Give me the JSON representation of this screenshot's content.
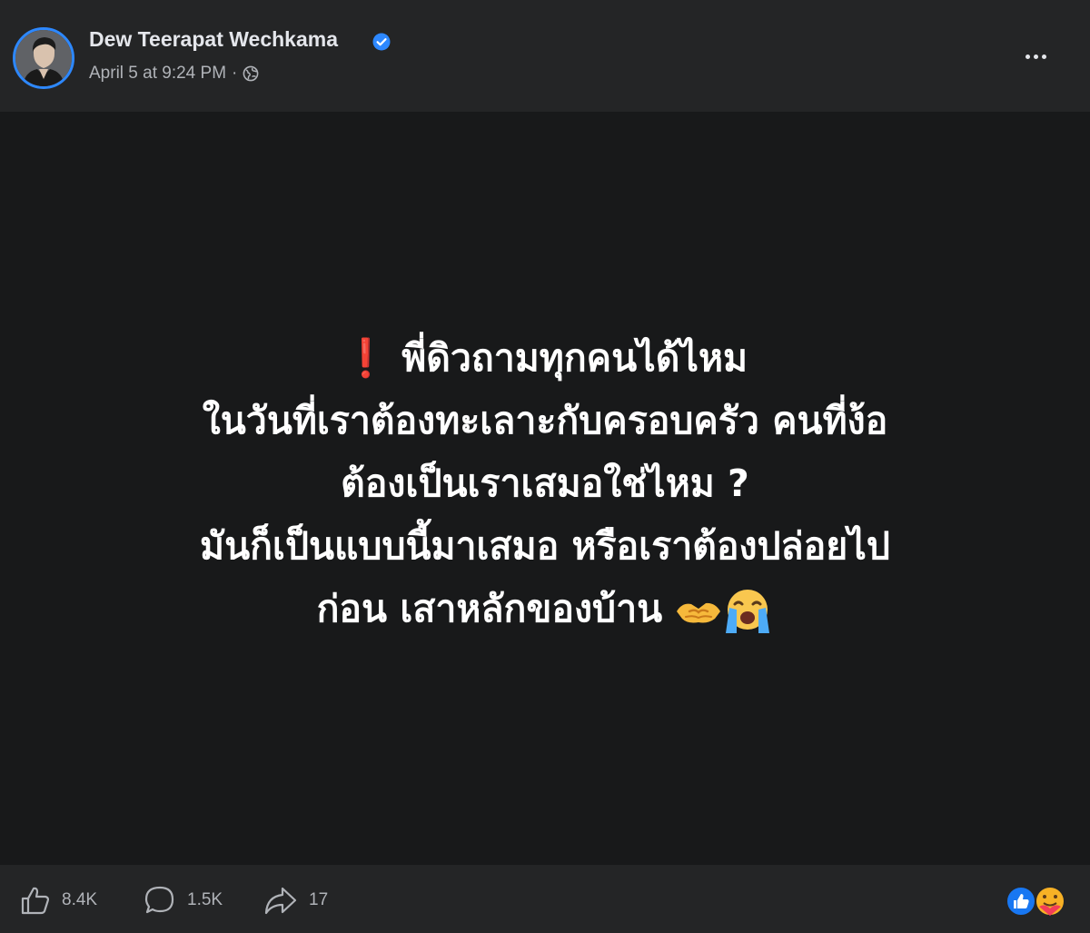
{
  "post": {
    "author": "Dew Teerapat Wechkama",
    "timestamp": "April 5 at 9:24 PM",
    "separator": "·",
    "verified_icon": "verified-badge-icon",
    "audience_icon": "globe-icon",
    "more_icon": "more-options-icon",
    "body_lines": [
      "❗ พี่ดิวถามทุกคนได้ไหม",
      "ในวันที่เราต้องทะเลาะกับครอบครัว คนที่ง้อ",
      "ต้องเป็นเราเสมอใช่ไหม ?",
      "มันก็เป็นแบบนี้มาเสมอ หรือเราต้องปล่อยไป",
      "ก่อน เสาหลักของบ้าน"
    ],
    "body_emojis": [
      "handshake-emoji",
      "crying-face-emoji"
    ],
    "colors": {
      "background": "#18191a",
      "header": "#242526",
      "accent": "#2d88ff",
      "text": "#ffffff",
      "secondary_text": "#b0b3b8",
      "exclamation": "#e0243b"
    }
  },
  "footer": {
    "like_count": "8.4K",
    "comment_count": "1.5K",
    "share_count": "17",
    "like_icon": "thumbs-up-icon",
    "comment_icon": "comment-bubble-icon",
    "share_icon": "share-arrow-icon",
    "reaction_icons": [
      "like-reaction-icon",
      "care-reaction-icon"
    ]
  }
}
